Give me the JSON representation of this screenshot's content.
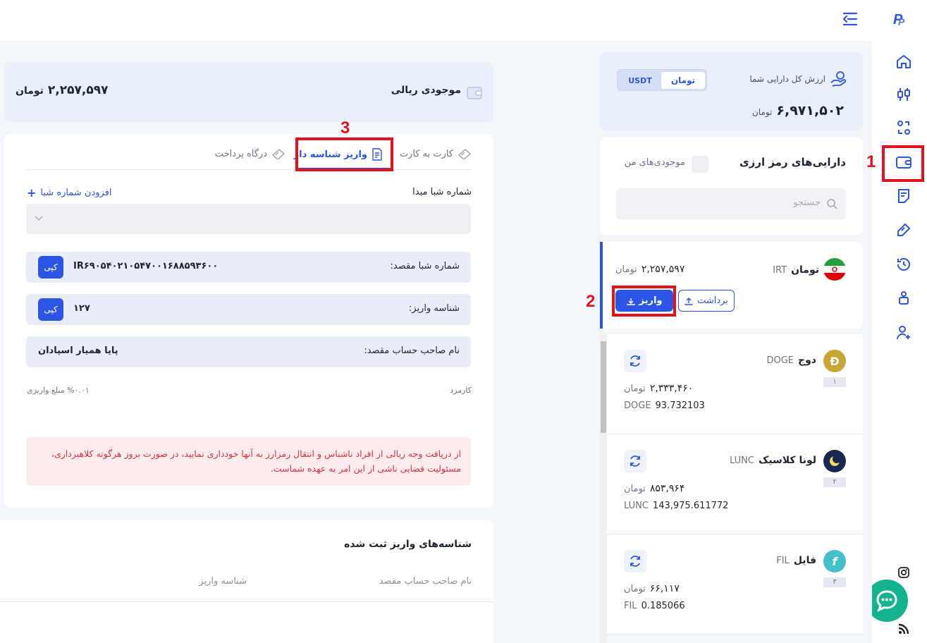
{
  "header": {
    "logo_icon": "logo-icon",
    "collapse_icon": "collapse-menu-icon"
  },
  "sidebar": {
    "items": [
      {
        "icon": "home-icon"
      },
      {
        "icon": "candlestick-icon"
      },
      {
        "icon": "exchange-icon"
      },
      {
        "icon": "wallet-icon"
      },
      {
        "icon": "orders-icon"
      },
      {
        "icon": "ticket-icon"
      },
      {
        "icon": "history-icon"
      },
      {
        "icon": "referral-icon"
      },
      {
        "icon": "user-add-icon"
      }
    ],
    "bottom": [
      "instagram-icon",
      "rss-icon"
    ]
  },
  "total_assets": {
    "label": "ارزش کل دارایی شما",
    "value": "۶,۹۷۱,۵۰۲",
    "unit": "تومان",
    "toggle": {
      "option1": "تومان",
      "option2": "USDT",
      "selected": "تومان"
    }
  },
  "crypto_assets": {
    "title": "دارایی‌های رمز ارزی",
    "my_balances_label": "موجودی‌های من",
    "search_placeholder": "جستجو"
  },
  "toman_asset": {
    "name": "تومان",
    "symbol": "IRT",
    "balance": "۲,۲۵۷,۵۹۷",
    "unit": "تومان",
    "deposit_label": "واریز",
    "withdraw_label": "برداشت"
  },
  "coins": [
    {
      "name": "دوج",
      "symbol": "DOGE",
      "rank": "۱",
      "toman_value": "۲,۳۳۳,۴۶۰",
      "unit": "تومان",
      "amount": "93.732103",
      "color": "#c9a634"
    },
    {
      "name": "لونا کلاسیک",
      "symbol": "LUNC",
      "rank": "۲",
      "toman_value": "۸۵۳,۹۶۴",
      "unit": "تومان",
      "amount": "143,975.611772",
      "color": "#172852"
    },
    {
      "name": "فایل",
      "symbol": "FIL",
      "rank": "۳",
      "toman_value": "۶۶,۱۱۷",
      "unit": "تومان",
      "amount": "0.185066",
      "color": "#42c1ca"
    }
  ],
  "rial_balance": {
    "label": "موجودی ریالی",
    "value": "۲,۲۵۷,۵۹۷",
    "unit": "تومان"
  },
  "deposit_tabs": {
    "tab_card": "کارت به کارت",
    "tab_id_deposit": "واریز شناسه دار",
    "tab_gateway": "درگاه پرداخت",
    "active": "واریز شناسه دار"
  },
  "deposit_form": {
    "source_sheba_label": "شماره شبا مبدا",
    "add_sheba_label": "افزودن شماره شبا",
    "dest_sheba_label": "شماره شبا مقصد:",
    "dest_sheba_value": "IR۶۹۰۵۴۰۲۱۰۵۴۷۰۰۱۶۸۸۵۹۳۶۰۰",
    "deposit_id_label": "شناسه واریز:",
    "deposit_id_value": "۱۲۷",
    "copy_label": "کپی",
    "account_owner_label": "نام صاحب حساب مقصد:",
    "account_owner_value": "پایا همیار اسپادان",
    "fee_label": "کارمزد",
    "fee_value": "%۰.۰۱ مبلغ واریزی",
    "warning": "از دریافت وجه ریالی از افراد ناشناس و انتقال رمزارز به آنها خودداری نمایید، در صورت بروز هرگونه کلاهبرداری، مسئولیت قضایی ناشی از این امر به عهده شماست."
  },
  "registered_ids": {
    "title": "شناسه‌های واریز ثبت شده",
    "col_owner": "نام صاحب حساب مقصد",
    "col_id": "شناسه واریز"
  },
  "annotations": [
    "1",
    "2",
    "3"
  ],
  "colors": {
    "accent": "#2a55e5",
    "annotation": "#e3121a",
    "warning_bg": "#fdecee",
    "warning_text": "#d8333f"
  }
}
